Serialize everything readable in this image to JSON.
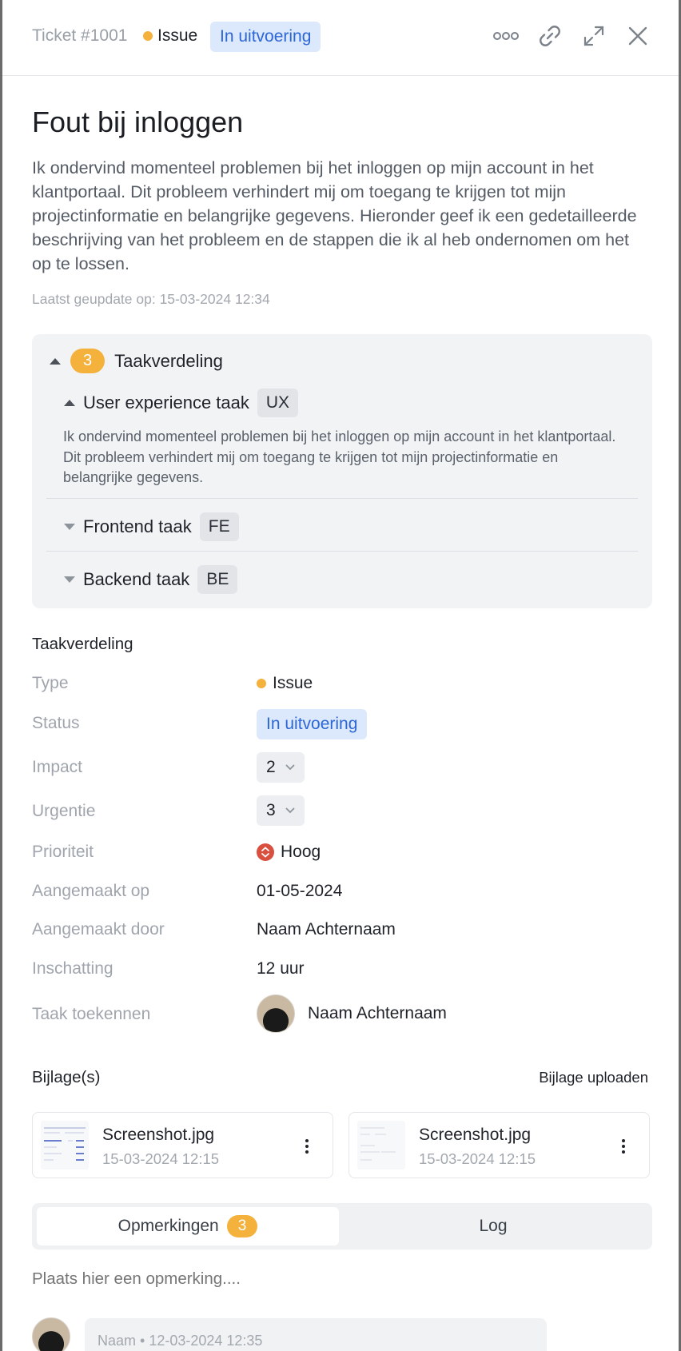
{
  "header": {
    "ticket": "Ticket #1001",
    "type": "Issue",
    "status": "In uitvoering",
    "icons": [
      "more-horizontal-icon",
      "link-icon",
      "expand-icon",
      "close-icon"
    ]
  },
  "ticket": {
    "title": "Fout bij inloggen",
    "description": "Ik ondervind momenteel problemen bij het inloggen op mijn account in het klantportaal. Dit probleem verhindert mij om toegang te krijgen tot mijn projectinformatie en belangrijke gegevens. Hieronder geef ik een gedetailleerde beschrijving van het probleem en de stappen die ik al heb ondernomen om het op te lossen.",
    "updated": "Laatst geupdate op: 15-03-2024 12:34"
  },
  "tasks": {
    "count": "3",
    "label": "Taakverdeling",
    "items": [
      {
        "label": "User experience taak",
        "tag": "UX",
        "expanded": true,
        "description": "Ik ondervind momenteel problemen bij het inloggen op mijn account in het klantportaal. Dit probleem verhindert mij om toegang te krijgen tot mijn projectinformatie en belangrijke gegevens."
      },
      {
        "label": "Frontend taak",
        "tag": "FE",
        "expanded": false
      },
      {
        "label": "Backend taak",
        "tag": "BE",
        "expanded": false
      }
    ]
  },
  "details": {
    "title": "Taakverdeling",
    "type_label": "Type",
    "type_value": "Issue",
    "status_label": "Status",
    "status_value": "In uitvoering",
    "impact_label": "Impact",
    "impact_value": "2",
    "urgency_label": "Urgentie",
    "urgency_value": "3",
    "priority_label": "Prioriteit",
    "priority_value": "Hoog",
    "created_label": "Aangemaakt op",
    "created_value": "01-05-2024",
    "created_by_label": "Aangemaakt door",
    "created_by_value": "Naam Achternaam",
    "estimate_label": "Inschatting",
    "estimate_value": "12 uur",
    "assign_label": "Taak toekennen",
    "assign_value": "Naam Achternaam"
  },
  "attachments": {
    "title": "Bijlage(s)",
    "upload_label": "Bijlage uploaden",
    "files": [
      {
        "name": "Screenshot.jpg",
        "date": "15-03-2024 12:15"
      },
      {
        "name": "Screenshot.jpg",
        "date": "15-03-2024 12:15"
      }
    ]
  },
  "tabs": {
    "comments_label": "Opmerkingen",
    "comments_count": "3",
    "log_label": "Log"
  },
  "comments": {
    "placeholder": "Plaats hier een opmerking....",
    "items": [
      {
        "meta": "Naam • 12-03-2024 12:35"
      }
    ]
  },
  "colors": {
    "issue_dot": "#f4b13c",
    "status_bg": "#dce8fb",
    "status_text": "#2d67d6",
    "priority_high": "#d9503f",
    "badge": "#f4b13c"
  }
}
